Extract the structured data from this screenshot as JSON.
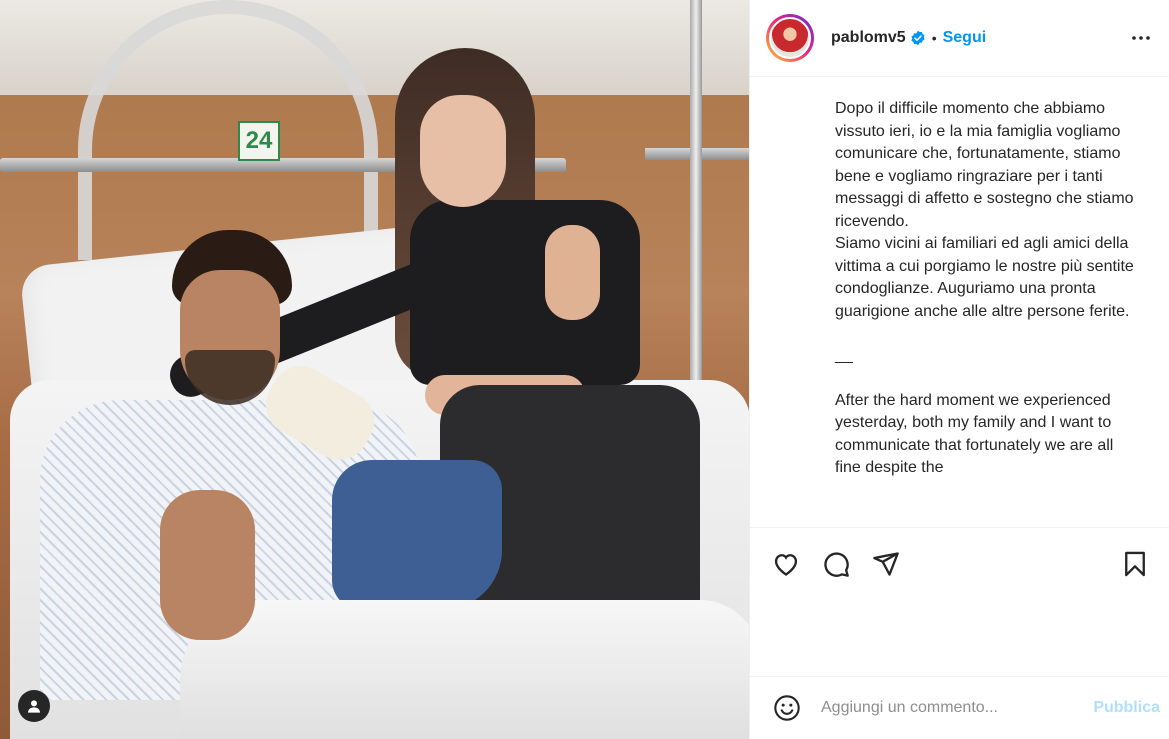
{
  "post": {
    "username": "pablomv5",
    "verified_icon": "verified-badge-icon",
    "separator": "•",
    "follow_label": "Segui",
    "more_icon": "more-options-icon"
  },
  "caption": {
    "italian": "Dopo il difficile momento che abbiamo vissuto ieri, io e la mia famiglia vogliamo comunicare che, fortunatamente, stiamo bene e vogliamo ringraziare per i tanti messaggi di affetto e sostegno che stiamo ricevendo.\nSiamo vicini ai familiari ed agli amici della vittima a cui porgiamo le nostre più sentite condoglianze. Auguriamo una pronta guarigione anche alle altre persone ferite.",
    "separator_line": "__",
    "english": "After the hard moment we experienced yesterday, both my family and I want to communicate that fortunately we are all fine despite the"
  },
  "photo": {
    "room_number": "24",
    "user_tag_icon": "user-tag-icon"
  },
  "actions": {
    "like_icon": "heart-icon",
    "comment_icon": "comment-icon",
    "share_icon": "share-icon",
    "save_icon": "bookmark-icon"
  },
  "comment_box": {
    "emoji_icon": "emoji-icon",
    "placeholder": "Aggiungi un commento...",
    "publish_label": "Pubblica"
  },
  "colors": {
    "accent": "#0095f6",
    "publish_disabled": "#b2dffc",
    "text": "#262626",
    "placeholder": "#8e8e8e"
  }
}
